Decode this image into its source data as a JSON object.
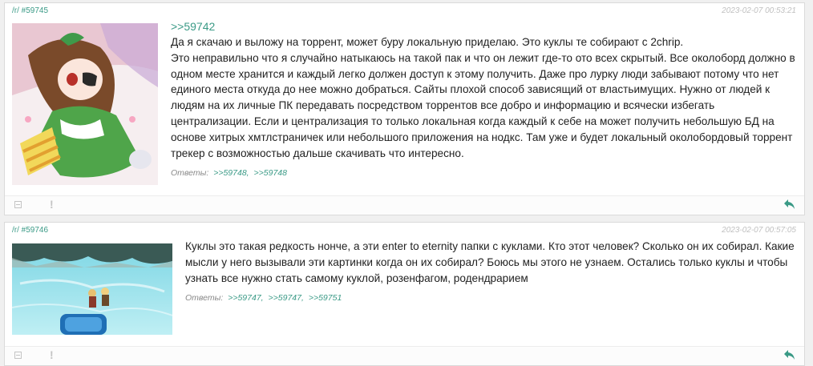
{
  "posts": [
    {
      "board_link": "/r/ #59745",
      "timestamp": "2023-02-07 00:53:21",
      "quote": ">>59742",
      "text": "Да я скачаю и выложу на торрент, может буру локальную приделаю. Это куклы те собирают с 2chrip.\nЭто неправильно что я случайно натыкаюсь на такой пак и что он лежит где-то ото всех скрытый. Все околоборд должно в одном месте хранится и каждый легко должен доступ к этому получить. Даже про лурку люди забывают потому что нет единого места откуда до нее можно добраться. Сайты плохой способ зависящий от властьимущих. Нужно от людей к людям на их личные ПК передавать посредством торрентов все добро и информацию и всячески избегать централизации. Если и централизация то только локальная когда каждый к себе на может получить небольшую БД на основе хитрых хмтлстраничек или небольшого приложения на нодкс. Там уже и будет локальный околобордовый торрент трекер с возможностью дальше скачивать что интересно.",
      "replies_label": "Ответы:",
      "replies": [
        ">>59748,",
        ">>59748"
      ]
    },
    {
      "board_link": "/r/ #59746",
      "timestamp": "2023-02-07 00:57:05",
      "text": "Куклы это такая редкость нонче, а эти enter to eternity папки с куклами. Кто этот человек? Сколько он их собирал. Какие мысли у него вызывали эти картинки когда он их собирал? Боюсь мы этого не узнаем. Остались только куклы и чтобы узнать все нужно стать самому куклой, розенфагом, родендрарием",
      "replies_label": "Ответы:",
      "replies": [
        ">>59747,",
        ">>59747,",
        ">>59751"
      ]
    }
  ],
  "icons": {
    "minimize": "minus-box-icon",
    "report": "exclamation-icon",
    "reply": "reply-arrow-icon"
  },
  "colors": {
    "accent": "#3a9a86",
    "timestamp": "#c0c0c0",
    "text": "#222222",
    "border": "#dadada",
    "background": "#f0f0f0"
  }
}
